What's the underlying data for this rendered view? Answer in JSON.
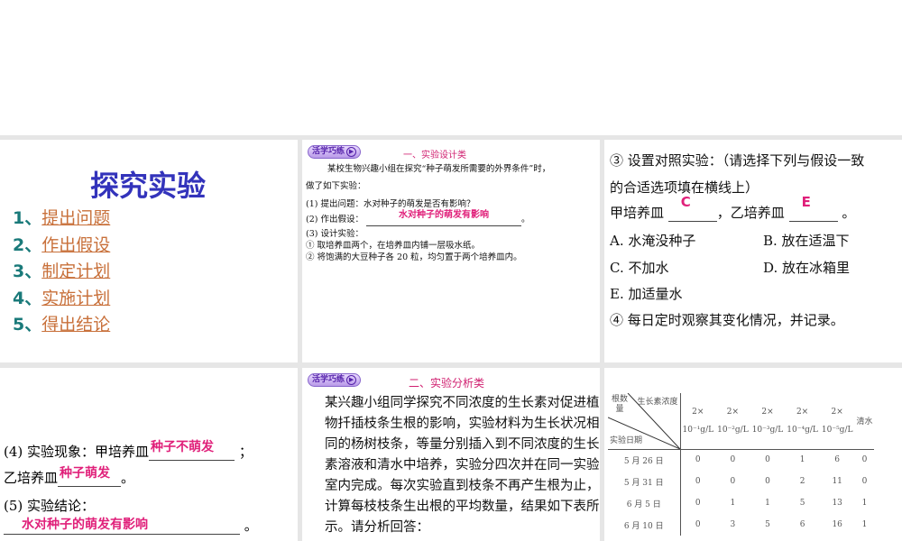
{
  "slide1": {
    "title": "探究实验",
    "steps": [
      {
        "num": "1、",
        "label": "提出问题"
      },
      {
        "num": "2、",
        "label": "作出假设"
      },
      {
        "num": "3、",
        "label": "制定计划"
      },
      {
        "num": "4、",
        "label": "实施计划"
      },
      {
        "num": "5、",
        "label": "得出结论"
      }
    ]
  },
  "badge": "活学巧练",
  "slide2": {
    "section": "一、实验设计类",
    "intro1": "某校生物兴趣小组在探究“种子萌发所需要的外界条件”时，",
    "intro2": "做了如下实验：",
    "q1": "(1) 提出问题：水对种子的萌发是否有影响？",
    "q2_label": "(2) 作出假设：",
    "q2_answer": "水对种子的萌发有影响",
    "q2_end": "。",
    "q3": "(3) 设计实验：",
    "s1": "① 取培养皿两个，在培养皿内铺一层吸水纸。",
    "s2": "② 将饱满的大豆种子各 20 粒，均匀置于两个培养皿内。"
  },
  "slide3": {
    "l1": "③ 设置对照实验：（请选择下列与假设一致",
    "l2": "的合适选项填在横线上）",
    "jia": "甲培养皿",
    "jia_ans": "C",
    "yi": "，乙培养皿",
    "yi_ans": "E",
    "end": "。",
    "A": "A. 水淹没种子",
    "B": "B. 放在适温下",
    "C": "C. 不加水",
    "D": "D. 放在冰箱里",
    "E": "E. 加适量水",
    "l4": "④ 每日定时观察其变化情况，并记录。"
  },
  "slide4": {
    "obs_label": "(4) 实验现象：甲培养皿",
    "obs_jia": "种子不萌发",
    "sep": "；",
    "yi_label": "乙培养皿",
    "obs_yi": "种子萌发",
    "end": "。",
    "concl_label": "(5) 实验结论：",
    "concl": "水对种子的萌发有影响",
    "concl_end": "。"
  },
  "slide5": {
    "section": "二、实验分析类",
    "para": [
      "某兴趣小组同学探究不同浓度的生长素对促进植",
      "物扦插枝条生根的影响，实验材料为生长状况相",
      "同的杨树枝条，等量分别插入到不同浓度的生长",
      "素溶液和清水中培养，实验分四次并在同一实验",
      "室内完成。每次实验直到枝条不再产生根为止，",
      "计算每枝枝条生出根的平均数量，结果如下表所",
      "示。请分析回答："
    ]
  },
  "table": {
    "corner_top": "生长素浓度",
    "corner_mid": "根数量",
    "corner_bot": "实验日期",
    "cols": [
      [
        "2×",
        "10⁻¹g/L"
      ],
      [
        "2×",
        "10⁻²g/L"
      ],
      [
        "2×",
        "10⁻³g/L"
      ],
      [
        "2×",
        "10⁻⁴g/L"
      ],
      [
        "2×",
        "10⁻⁵g/L"
      ],
      [
        "",
        "清水"
      ]
    ],
    "rows": [
      {
        "date": "5 月 26 日",
        "v": [
          "0",
          "0",
          "0",
          "1",
          "6",
          "0"
        ]
      },
      {
        "date": "5 月 31 日",
        "v": [
          "0",
          "0",
          "0",
          "2",
          "11",
          "0"
        ]
      },
      {
        "date": "6 月 5 日",
        "v": [
          "0",
          "1",
          "1",
          "5",
          "13",
          "1"
        ]
      },
      {
        "date": "6 月 10 日",
        "v": [
          "0",
          "3",
          "5",
          "6",
          "16",
          "1"
        ]
      }
    ]
  }
}
